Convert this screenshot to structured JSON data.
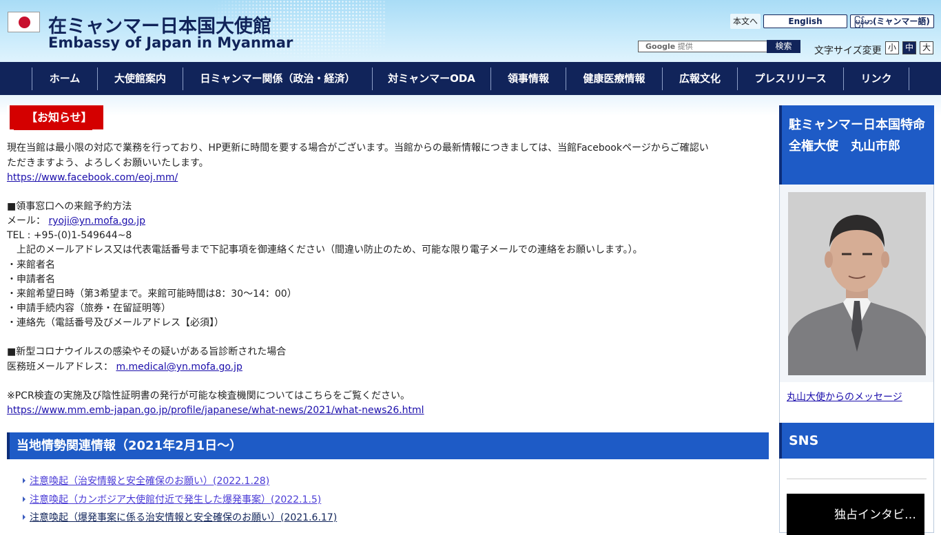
{
  "header": {
    "title_ja": "在ミャンマー日本国大使館",
    "title_en": "Embassy of Japan in Myanmar",
    "skip_link": "本文へ",
    "lang_en": "English",
    "lang_my": "မြန်မာ(ミャンマー語)",
    "search_brand": "Google",
    "search_provided": "提供",
    "search_button": "検索",
    "fontsize_label": "文字サイズ変更",
    "fontsize_small": "小",
    "fontsize_medium": "中",
    "fontsize_large": "大",
    "flag_color": "#c8102e"
  },
  "nav": {
    "items": [
      "ホーム",
      "大使館案内",
      "日ミャンマー関係（政治・経済）",
      "対ミャンマーODA",
      "領事情報",
      "健康医療情報",
      "広報文化",
      "プレスリリース",
      "リンク"
    ]
  },
  "notice": {
    "heading": "【お知らせ】",
    "p1": "現在当館は最小限の対応で業務を行っており、HP更新に時間を要する場合がございます。当館からの最新情報につきましては、当館Facebookページからご確認い",
    "p1b": "ただきますよう、よろしくお願いいたします。",
    "facebook_link": "https://www.facebook.com/eoj.mm/",
    "reservation_title": "■領事窓口への来館予約方法",
    "mail_label": "メール：",
    "mail_link": "ryoji@yn.mofa.go.jp",
    "tel": "TEL : +95-(0)1-549644~8",
    "instruction": "　上記のメールアドレス又は代表電話番号まで下記事項を御連絡ください（間違い防止のため、可能な限り電子メールでの連絡をお願いします。）。",
    "items": [
      "・来館者名",
      "・申請者名",
      "・来館希望日時（第3希望まで。来館可能時間は8：30～14：00）",
      "・申請手続内容（旅券・在留証明等）",
      "・連絡先（電話番号及びメールアドレス【必須】）"
    ],
    "covid_title": "■新型コロナウイルスの感染やその疑いがある旨診断された場合",
    "medical_label": "医務班メールアドレス：",
    "medical_link": "m.medical@yn.mofa.go.jp",
    "pcr_note": "※PCR検査の実施及び陰性証明書の発行が可能な検査機関についてはこちらをご覧ください。",
    "pcr_link": "https://www.mm.emb-japan.go.jp/profile/japanese/what-news/2021/what-news26.html"
  },
  "situation": {
    "heading": "当地情勢関連情報（2021年2月1日～）",
    "news": [
      "注意喚起（治安情報と安全確保のお願い）(2022.1.28)",
      "注意喚起（カンボジア大使館付近で発生した爆発事案）(2022.1.5)",
      "注意喚起（爆発事案に係る治安情報と安全確保のお願い）(2021.6.17)"
    ]
  },
  "sidebar": {
    "ambassador_title": "駐ミャンマー日本国特命全権大使　丸山市郎",
    "ambassador_message_link": "丸山大使からのメッセージ",
    "sns_title": "SNS",
    "video_caption": "独占インタビ…"
  }
}
